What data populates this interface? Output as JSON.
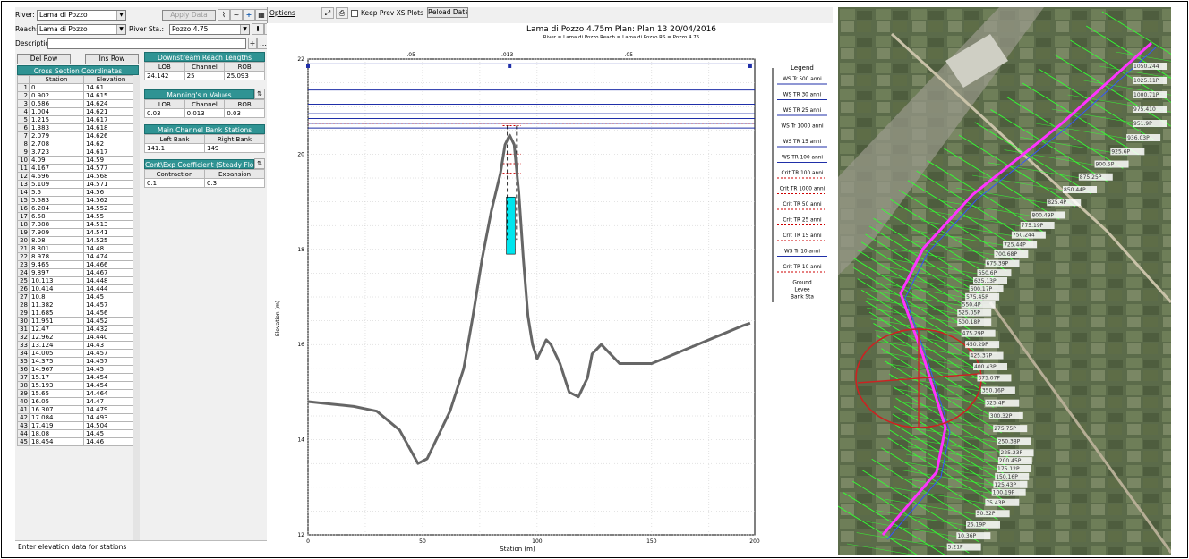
{
  "window": {
    "border_color": "#000000"
  },
  "left_panel": {
    "river_label": "River:",
    "river_value": "Lama di Pozzo",
    "reach_label": "Reach:",
    "reach_value": "Lama di Pozzo",
    "river_sta_label": "River Sta.:",
    "river_sta_value": "Pozzo 4.75",
    "description_label": "Description",
    "description_value": "",
    "apply_data_label": "Apply Data",
    "del_row_label": "Del Row",
    "ins_row_label": "Ins Row",
    "status_text": "Enter elevation data for stations"
  },
  "xs_table": {
    "title": "Cross Section Coordinates",
    "headers": [
      "Station",
      "Elevation"
    ],
    "rows": [
      [
        "1",
        "0",
        "14.61"
      ],
      [
        "2",
        "0.902",
        "14.615"
      ],
      [
        "3",
        "0.586",
        "14.624"
      ],
      [
        "4",
        "1.004",
        "14.621"
      ],
      [
        "5",
        "1.215",
        "14.617"
      ],
      [
        "6",
        "1.383",
        "14.618"
      ],
      [
        "7",
        "2.079",
        "14.626"
      ],
      [
        "8",
        "2.708",
        "14.62"
      ],
      [
        "9",
        "3.723",
        "14.617"
      ],
      [
        "10",
        "4.09",
        "14.59"
      ],
      [
        "11",
        "4.167",
        "14.577"
      ],
      [
        "12",
        "4.596",
        "14.568"
      ],
      [
        "13",
        "5.109",
        "14.571"
      ],
      [
        "14",
        "5.5",
        "14.56"
      ],
      [
        "15",
        "5.583",
        "14.562"
      ],
      [
        "16",
        "6.284",
        "14.552"
      ],
      [
        "17",
        "6.58",
        "14.55"
      ],
      [
        "18",
        "7.388",
        "14.513"
      ],
      [
        "19",
        "7.909",
        "14.541"
      ],
      [
        "20",
        "8.08",
        "14.525"
      ],
      [
        "21",
        "8.301",
        "14.48"
      ],
      [
        "22",
        "8.978",
        "14.474"
      ],
      [
        "23",
        "9.465",
        "14.466"
      ],
      [
        "24",
        "9.897",
        "14.467"
      ],
      [
        "25",
        "10.113",
        "14.448"
      ],
      [
        "26",
        "10.414",
        "14.444"
      ],
      [
        "27",
        "10.8",
        "14.45"
      ],
      [
        "28",
        "11.382",
        "14.457"
      ],
      [
        "29",
        "11.685",
        "14.456"
      ],
      [
        "30",
        "11.951",
        "14.452"
      ],
      [
        "31",
        "12.47",
        "14.432"
      ],
      [
        "32",
        "12.962",
        "14.440"
      ],
      [
        "33",
        "13.124",
        "14.43"
      ],
      [
        "34",
        "14.005",
        "14.457"
      ],
      [
        "35",
        "14.375",
        "14.457"
      ],
      [
        "36",
        "14.967",
        "14.45"
      ],
      [
        "37",
        "15.17",
        "14.454"
      ],
      [
        "38",
        "15.193",
        "14.454"
      ],
      [
        "39",
        "15.65",
        "14.464"
      ],
      [
        "40",
        "16.05",
        "14.47"
      ],
      [
        "41",
        "16.307",
        "14.479"
      ],
      [
        "42",
        "17.084",
        "14.493"
      ],
      [
        "43",
        "17.419",
        "14.504"
      ],
      [
        "44",
        "18.08",
        "14.45"
      ],
      [
        "45",
        "18.454",
        "14.46"
      ]
    ]
  },
  "reach_lengths": {
    "title": "Downstream Reach Lengths",
    "headers": [
      "LOB",
      "Channel",
      "ROB"
    ],
    "values": [
      "24.142",
      "25",
      "25.093"
    ]
  },
  "manning": {
    "title": "Manning's n Values",
    "headers": [
      "LOB",
      "Channel",
      "ROB"
    ],
    "values": [
      "0.03",
      "0.013",
      "0.03"
    ]
  },
  "bank_stations": {
    "title": "Main Channel Bank Stations",
    "headers": [
      "Left Bank",
      "Right Bank"
    ],
    "values": [
      "141.1",
      "149"
    ]
  },
  "coefficients": {
    "title": "Cont\\Exp Coefficient (Steady Flow)",
    "headers": [
      "Contraction",
      "Expansion"
    ],
    "values": [
      "0.1",
      "0.3"
    ]
  },
  "chart_toolbar": {
    "options_label": "Options",
    "keep_prev_label": "Keep Prev XS Plots",
    "reload_label": "Reload Data"
  },
  "chart_data": {
    "type": "line",
    "title": "Lama di Pozzo 4.75m      Plan: Plan 13    20/04/2016",
    "subtitle": "River = Lama di Pozzo   Reach = Lama di Pozzo   RS = Pozzo 4.75",
    "xlabel": "Station (m)",
    "ylabel": "Elevation (m)",
    "xlim": [
      0,
      195
    ],
    "ylim": [
      12,
      22
    ],
    "x_ticks": [
      "0",
      "50",
      "100",
      "150",
      "200"
    ],
    "y_ticks": [
      "12",
      "14",
      "16",
      "18",
      "20",
      "22"
    ],
    "top_ticks": [
      ".05",
      ".013",
      ".05"
    ],
    "ground_color": "#666666",
    "ground": {
      "x": [
        0,
        10,
        20,
        30,
        40,
        48,
        52,
        56,
        62,
        68,
        72,
        76,
        80,
        84,
        86,
        88,
        90,
        92,
        94,
        96,
        98,
        100,
        102,
        104,
        106,
        110,
        114,
        118,
        122,
        124,
        128,
        132,
        136,
        140,
        145,
        150,
        160,
        170,
        180,
        190,
        193
      ],
      "y": [
        14.8,
        14.75,
        14.7,
        14.6,
        14.2,
        13.5,
        13.6,
        14.0,
        14.6,
        15.5,
        16.6,
        17.8,
        18.8,
        19.6,
        20.2,
        20.4,
        20.2,
        19.2,
        17.8,
        16.6,
        16.0,
        15.7,
        15.9,
        16.1,
        16.0,
        15.6,
        15.0,
        14.9,
        15.3,
        15.8,
        16.0,
        15.8,
        15.6,
        15.6,
        15.6,
        15.6,
        15.8,
        16.0,
        16.2,
        16.4,
        16.45
      ]
    },
    "bank_left_x": 87.0,
    "bank_right_x": 91.0,
    "obstruction": {
      "x": [
        86.6,
        90.4
      ],
      "y_bottom": 17.9,
      "y_top": 19.1,
      "color": "#00e5ee"
    },
    "legend_title": "Legend",
    "series": [
      {
        "name": "WS Tr 500 anni",
        "y": 21.9,
        "style": "ws"
      },
      {
        "name": "WS TR 30 anni",
        "y": 21.35,
        "style": "ws"
      },
      {
        "name": "WS TR 25 anni",
        "y": 21.05,
        "style": "ws"
      },
      {
        "name": "WS Tr 1000 anni",
        "y": 20.85,
        "style": "ws"
      },
      {
        "name": "WS TR 15 anni",
        "y": 20.75,
        "style": "ws"
      },
      {
        "name": "WS TR 100 anni",
        "y": 20.65,
        "style": "ws"
      },
      {
        "name": "Crit TR 100 anni",
        "y": 20.65,
        "style": "crit"
      },
      {
        "name": "Crit TR 1000 anni",
        "y": 20.6,
        "style": "crit"
      },
      {
        "name": "Crit TR 50 anni",
        "y": 20.3,
        "style": "crit"
      },
      {
        "name": "Crit TR 25 anni",
        "y": 20.0,
        "style": "crit"
      },
      {
        "name": "Crit TR 15 anni",
        "y": 19.8,
        "style": "crit"
      },
      {
        "name": "WS Tr 10 anni",
        "y": 20.55,
        "style": "ws"
      },
      {
        "name": "Crit TR 10 anni",
        "y": 19.6,
        "style": "crit"
      }
    ],
    "legend_extra": [
      "Ground",
      "Levee",
      "Bank Sta"
    ]
  },
  "map": {
    "labels": [
      "1050.244",
      "1025.11P",
      "1000.71P",
      "975.410",
      "951.9P",
      "936.03P",
      "925.6P",
      "900.5P",
      "875.25P",
      "850.44P",
      "825.4P",
      "800.49P",
      "775.19P",
      "750.244",
      "725.44P",
      "700.68P",
      "675.39P",
      "650.6P",
      "625.13P",
      "600.17P",
      "575.45P",
      "550.4P",
      "525.05P",
      "500.18P",
      "475.29P",
      "450.29P",
      "425.37P",
      "400.43P",
      "375.07P",
      "350.16P",
      "325.4P",
      "300.32P",
      "275.75P",
      "250.38P",
      "225.23P",
      "200.45P",
      "175.12P",
      "150.16P",
      "125.43P",
      "100.19P",
      "75.43P",
      "50.32P",
      "25.19P",
      "10.36P",
      "5.21P",
      "0.00"
    ],
    "xs_color": "#33ff33",
    "centerline_color": "#ff33ff",
    "circle_color": "#cc2222"
  }
}
